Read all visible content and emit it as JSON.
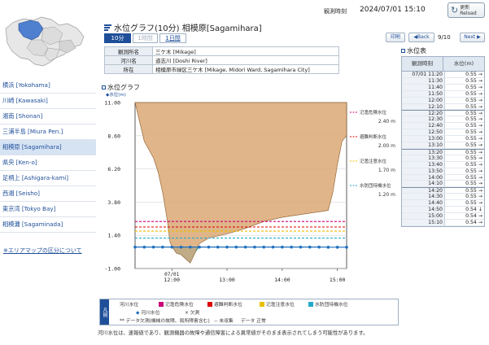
{
  "top": {
    "obs_time_label": "観測時刻",
    "obs_time_value": "2024/07/01 15:10",
    "reload_label_1": "更新",
    "reload_label_2": "Reload"
  },
  "title": "水位グラフ(10分) 相模原[Sagamihara]",
  "tabs": {
    "min10": "10分",
    "hour1": "1時間",
    "day1": "1日間"
  },
  "station": {
    "name_key": "観測所名",
    "name_val": "三ケ木 [Mikage]",
    "river_key": "河川名",
    "river_val": "道志川 [Doshi River]",
    "loc_key": "所在",
    "loc_val": "相模原市緑区三ケ木 [Mikage, Midori Ward, Sagamihara City]"
  },
  "nav": {
    "print": "印刷",
    "back": "◀Back",
    "page": "9/10",
    "next": "Next ▶"
  },
  "sidebar": {
    "items": [
      "横浜 [Yokohama]",
      "川崎 [Kawasaki]",
      "湘南 [Shonan]",
      "三浦半島 [Miura Pen.]",
      "相模原 [Sagamihara]",
      "県央 [Ken-o]",
      "足柄上 [Ashigara-kami]",
      "西湘 [Seisho]",
      "東京湾 [Tokyo Bay]",
      "相模灘 [Sagaminada]"
    ],
    "active_index": 4,
    "area_map_link": "※エリアマップの区分について"
  },
  "wl_table": {
    "title": "水位表",
    "col_time": "観測時刻",
    "col_level": "水位(m)",
    "rows": [
      {
        "t": "07/01 11:20",
        "v": "0.55 →",
        "hr": false
      },
      {
        "t": "11:30",
        "v": "0.55 →",
        "hr": false
      },
      {
        "t": "11:40",
        "v": "0.55 →",
        "hr": false
      },
      {
        "t": "11:50",
        "v": "0.55 →",
        "hr": false
      },
      {
        "t": "12:00",
        "v": "0.55 →",
        "hr": false
      },
      {
        "t": "12:10",
        "v": "0.55 →",
        "hr": false
      },
      {
        "t": "12:20",
        "v": "0.55 →",
        "hr": true
      },
      {
        "t": "12:30",
        "v": "0.55 →",
        "hr": false
      },
      {
        "t": "12:40",
        "v": "0.55 →",
        "hr": false
      },
      {
        "t": "12:50",
        "v": "0.55 →",
        "hr": false
      },
      {
        "t": "13:00",
        "v": "0.55 →",
        "hr": false
      },
      {
        "t": "13:10",
        "v": "0.55 →",
        "hr": false
      },
      {
        "t": "13:20",
        "v": "0.55 →",
        "hr": true
      },
      {
        "t": "13:30",
        "v": "0.55 →",
        "hr": false
      },
      {
        "t": "13:40",
        "v": "0.55 →",
        "hr": false
      },
      {
        "t": "13:50",
        "v": "0.55 →",
        "hr": false
      },
      {
        "t": "14:00",
        "v": "0.55 →",
        "hr": false
      },
      {
        "t": "14:10",
        "v": "0.55 →",
        "hr": false
      },
      {
        "t": "14:20",
        "v": "0.55 →",
        "hr": true
      },
      {
        "t": "14:30",
        "v": "0.55 →",
        "hr": false
      },
      {
        "t": "14:40",
        "v": "0.55 →",
        "hr": false
      },
      {
        "t": "14:50",
        "v": "0.54 ↓",
        "hr": false
      },
      {
        "t": "15:00",
        "v": "0.54 →",
        "hr": false
      },
      {
        "t": "15:10",
        "v": "0.54 →",
        "hr": false
      }
    ]
  },
  "chart_data": {
    "type": "line",
    "title": "水位グラフ",
    "series_label": "水位(m)",
    "ylim": [
      -1.0,
      11.0
    ],
    "yticks": [
      -1.0,
      1.4,
      3.8,
      6.2,
      8.6,
      11.0
    ],
    "ytick_labels": [
      "-1.00",
      "1.40",
      "3.80",
      "6.20",
      "8.60",
      "11.00"
    ],
    "xticks": [
      {
        "label1": "07/01",
        "label2": "12:00",
        "min": 40
      },
      {
        "label1": "",
        "label2": "13:00",
        "min": 100
      },
      {
        "label1": "",
        "label2": "14:00",
        "min": 160
      },
      {
        "label1": "",
        "label2": "15:00",
        "min": 220
      }
    ],
    "xrange_min": [
      0,
      230
    ],
    "series": [
      {
        "name": "水位",
        "x_min": [
          0,
          10,
          20,
          30,
          40,
          50,
          60,
          70,
          80,
          90,
          100,
          110,
          120,
          130,
          140,
          150,
          160,
          170,
          180,
          190,
          200,
          210,
          220,
          230
        ],
        "values": [
          0.55,
          0.55,
          0.55,
          0.55,
          0.55,
          0.55,
          0.55,
          0.55,
          0.55,
          0.55,
          0.55,
          0.55,
          0.55,
          0.55,
          0.55,
          0.55,
          0.55,
          0.55,
          0.55,
          0.55,
          0.55,
          0.54,
          0.54,
          0.54
        ]
      }
    ],
    "thresholds": [
      {
        "name": "氾濫危険水位",
        "value": 2.4,
        "label": "2.40 m",
        "color": "#cc0077"
      },
      {
        "name": "避難判断水位",
        "value": 2.0,
        "label": "2.00 m",
        "color": "#dd0000"
      },
      {
        "name": "氾濫注意水位",
        "value": 1.7,
        "label": "1.70 m",
        "color": "#e8c000"
      },
      {
        "name": "水防団待機水位",
        "value": 1.2,
        "label": "1.20 m",
        "color": "#22aacc"
      }
    ],
    "riverbed_x": [
      0,
      10,
      20,
      25,
      30,
      35,
      38,
      40,
      45,
      50,
      55,
      60,
      65,
      70,
      80,
      100,
      120,
      140,
      160,
      180,
      200,
      210,
      215,
      220,
      225,
      230
    ],
    "riverbed_y": [
      11.0,
      8.2,
      7.0,
      6.0,
      4.5,
      2.5,
      0.9,
      0.6,
      0.1,
      0.0,
      -0.3,
      -0.6,
      0.1,
      0.8,
      1.2,
      1.5,
      1.9,
      2.4,
      2.7,
      2.9,
      3.1,
      3.2,
      4.5,
      6.5,
      8.2,
      8.6
    ]
  },
  "legend": {
    "tag": "凡例",
    "river_level": "河川水位",
    "danger": "氾濫危険水位",
    "evac": "避難判断水位",
    "caution": "氾濫注意水位",
    "standby": "水防団待機水位",
    "level_mark": "河川水位",
    "missing": "欠測",
    "double_star": "**",
    "double_star_note": "データ欠測(機械の故障、局所障害含む)",
    "dashdash": "--",
    "dashdash_note": "未収集",
    "normal_label": "データ",
    "normal_note": "正常"
  },
  "footnote": "河川水位は、速報値であり、観測機器の故障や通信障害による異常値がそのまま表示されてしまう可能性があります。"
}
